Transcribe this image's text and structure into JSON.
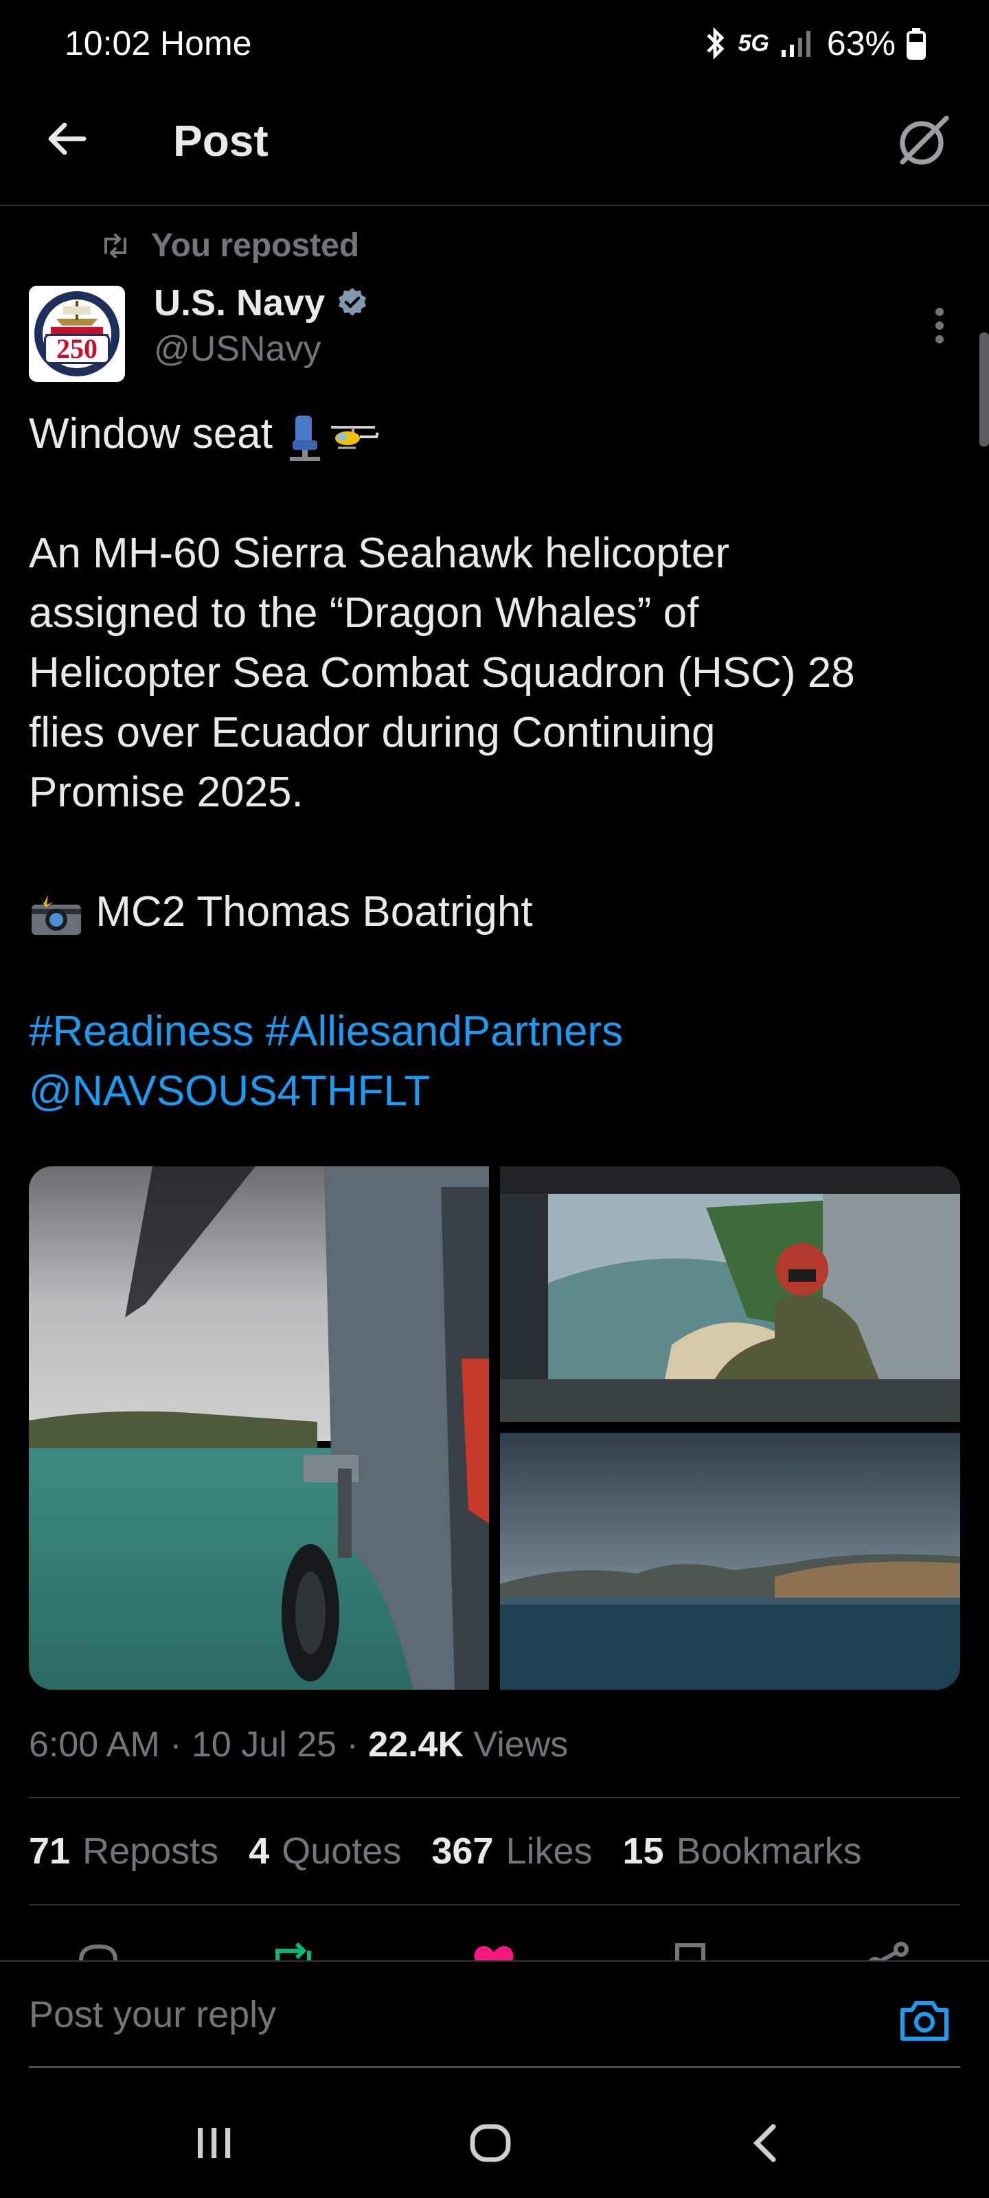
{
  "status_bar": {
    "time": "10:02",
    "app": "Home",
    "network": "5G",
    "battery": "63%"
  },
  "header": {
    "title": "Post"
  },
  "repost": {
    "label": "You reposted"
  },
  "author": {
    "name": "U.S. Navy",
    "handle": "@USNavy",
    "avatar_text": "250",
    "verified_color": "#829aab"
  },
  "post": {
    "line1": "Window seat",
    "paragraph": "An MH-60 Sierra Seahawk helicopter assigned to the “Dragon Whales” of Helicopter Sea Combat Squadron (HSC) 28 flies over Ecuador during Continuing Promise 2025.",
    "credit": "MC2 Thomas Boatright",
    "hashtag1": "#Readiness",
    "hashtag2": "#AlliesandPartners",
    "mention": "@NAVSOUS4THFLT",
    "link_color": "#1d9bf0"
  },
  "meta": {
    "time": "6:00 AM",
    "date": "10 Jul 25",
    "views_count": "22.4K",
    "views_label": "Views"
  },
  "stats": [
    {
      "count": "71",
      "label": "Reposts"
    },
    {
      "count": "4",
      "label": "Quotes"
    },
    {
      "count": "367",
      "label": "Likes"
    },
    {
      "count": "15",
      "label": "Bookmarks"
    }
  ],
  "reply": {
    "placeholder": "Post your reply"
  },
  "colors": {
    "background": "#000000",
    "text": "#e7e9ea",
    "muted": "#71767b",
    "accent": "#1d9bf0",
    "repost_green": "#00ba7c",
    "like_pink": "#f91880"
  }
}
